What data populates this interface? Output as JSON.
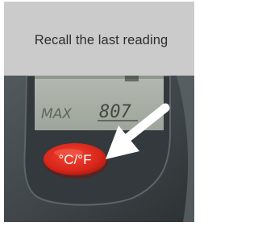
{
  "caption": {
    "text": "Recall the last reading"
  },
  "display": {
    "mode": "MAX",
    "reading": "807"
  },
  "button": {
    "label": "°C/°F"
  },
  "icons": {
    "arrow": "arrow-pointing-down-left-icon"
  },
  "colors": {
    "caption_bar": "#cbcbcb",
    "device_body": "#3e4447",
    "lcd": "#a9b0a7",
    "button_red": "#e02a1c",
    "arrow": "#ffffff"
  }
}
